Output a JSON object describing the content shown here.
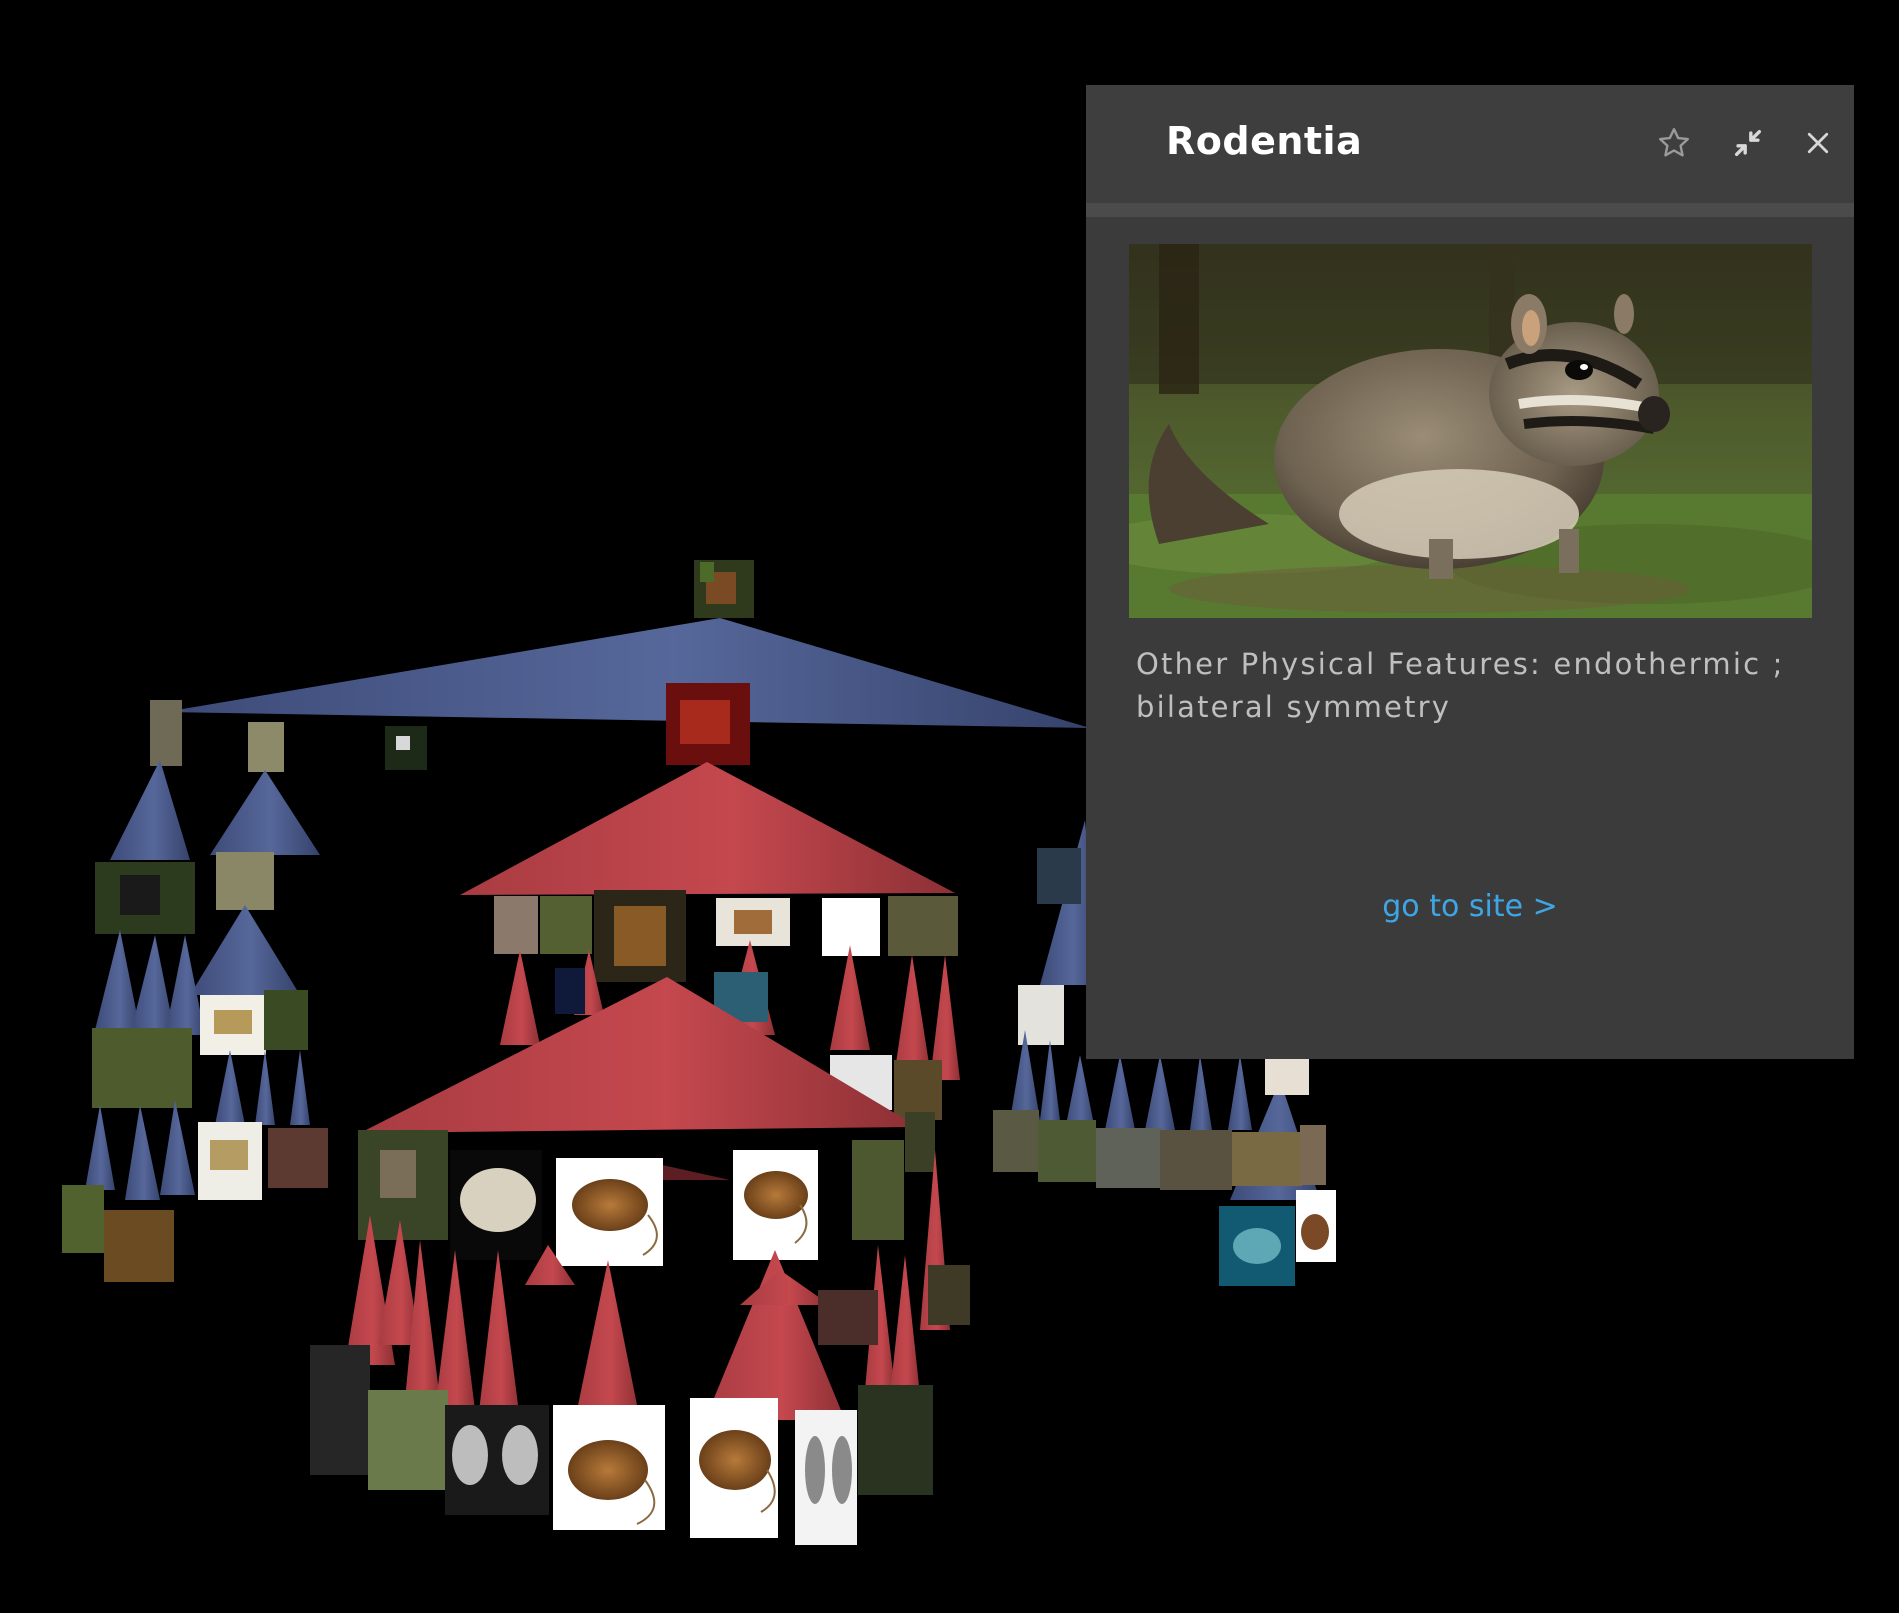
{
  "panel": {
    "title": "Rodentia",
    "description": "Other Physical Features: endothermic ; bilateral symmetry",
    "link_label": "go to site >",
    "icons": {
      "favorite": "star-icon",
      "collapse": "collapse-icon",
      "close": "close-icon"
    }
  },
  "colors": {
    "background": "#000000",
    "blue_branch": "#4a5a8a",
    "red_branch": "#b8454a",
    "panel_bg": "#3b3b3b",
    "panel_header": "#3e3e3e",
    "link": "#3ea6e6"
  }
}
